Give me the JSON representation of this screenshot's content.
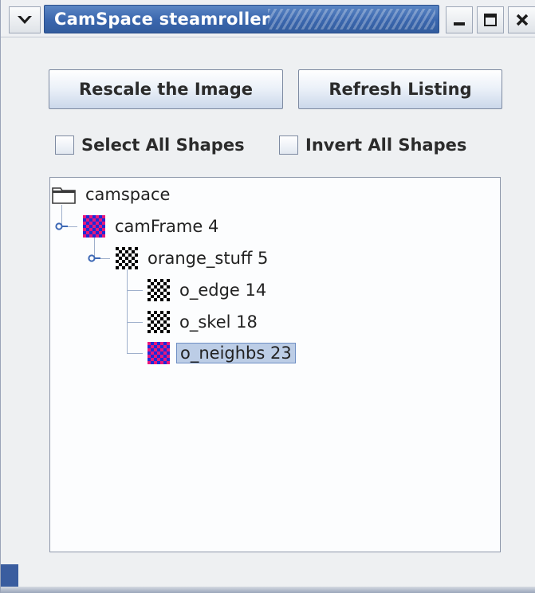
{
  "window": {
    "title": "CamSpace steamroller",
    "accent_color": "#3a66ad",
    "icons": {
      "system_menu": "chevron-down-icon",
      "minimize": "minimize-icon",
      "maximize": "maximize-icon",
      "close": "close-icon"
    }
  },
  "toolbar": {
    "rescale_label": "Rescale the Image",
    "refresh_label": "Refresh Listing"
  },
  "options": {
    "select_all_label": "Select All Shapes",
    "select_all_checked": false,
    "invert_all_label": "Invert All Shapes",
    "invert_all_checked": false
  },
  "tree": {
    "root": {
      "label": "camspace",
      "icon": "folder-icon"
    },
    "nodes": [
      {
        "label": "camFrame 4",
        "icon": "magenta-blue-checker-icon",
        "level": 1,
        "expanded": true
      },
      {
        "label": "orange_stuff 5",
        "icon": "black-white-checker-icon",
        "level": 2,
        "expanded": true
      },
      {
        "label": "o_edge 14",
        "icon": "black-white-checker-icon",
        "level": 3
      },
      {
        "label": "o_skel 18",
        "icon": "black-white-checker-icon",
        "level": 3
      },
      {
        "label": "o_neighbs 23",
        "icon": "magenta-blue-checker-icon",
        "level": 3,
        "selected": true
      }
    ],
    "selection_color": "#bccde6"
  }
}
